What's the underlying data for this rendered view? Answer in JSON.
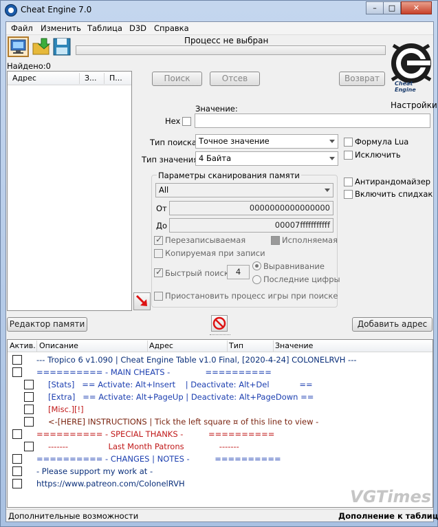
{
  "window": {
    "title": "Cheat Engine 7.0"
  },
  "menu": [
    "Файл",
    "Изменить",
    "Таблица",
    "D3D",
    "Справка"
  ],
  "process": {
    "label": "Процесс не выбран",
    "found": "Найдено:0"
  },
  "address_list": {
    "columns": [
      "Адрес",
      "З...",
      "П..."
    ]
  },
  "buttons": {
    "search": "Поиск",
    "filter": "Отсев",
    "return": "Возврат",
    "memory_editor": "Редактор памяти",
    "add_address": "Добавить адрес"
  },
  "logo": {
    "text": "Cheat Engine"
  },
  "settings_label": "Настройки",
  "value": {
    "label": "Значение:",
    "hex_label": "Hex",
    "value": ""
  },
  "scan_type": {
    "label": "Тип поиска",
    "selected": "Точное значение"
  },
  "value_type": {
    "label": "Тип значения",
    "selected": "4 Байта"
  },
  "memory_scan": {
    "title": "Параметры сканирования памяти",
    "region": "All",
    "from_label": "От",
    "from": "0000000000000000",
    "to_label": "До",
    "to": "00007fffffffffff",
    "writable": "Перезаписываемая",
    "executable": "Исполняемая",
    "copy_on_write": "Копируемая при записи",
    "fast_scan": "Быстрый поиск",
    "fast_scan_value": "4",
    "alignment": "Выравнивание",
    "last_digits": "Последние цифры",
    "pause": "Приостановить процесс игры при поиске"
  },
  "options": {
    "lua_formula": "Формула Lua",
    "exclude": "Исключить",
    "anti_randomizer": "Антирандомайзер",
    "speedhack": "Включить спидхак"
  },
  "table": {
    "columns": [
      "Актив.",
      "Описание",
      "Адрес",
      "Тип",
      "Значение"
    ],
    "rows": [
      {
        "text": "--- Tropico 6 v1.090 | Cheat Engine Table v1.0 Final, [2020-4-24] COLONELRVH ---",
        "color": "#0a2f7a",
        "indent": 0
      },
      {
        "text": "========== - MAIN CHEATS -              ==========",
        "color": "#1c3fb0",
        "indent": 0
      },
      {
        "text": "[Stats]   == Activate: Alt+Insert    | Deactivate: Alt+Del            ==",
        "color": "#1c3fb0",
        "indent": 1
      },
      {
        "text": "[Extra]   == Activate: Alt+PageUp | Deactivate: Alt+PageDown ==",
        "color": "#1c3fb0",
        "indent": 1
      },
      {
        "text": "[Misc.][!]",
        "color": "#c01818",
        "indent": 1
      },
      {
        "text": "<-[HERE] INSTRUCTIONS | Tick the left square ¤ of this line to view -",
        "color": "#7a2410",
        "indent": 1
      },
      {
        "text": "========== - SPECIAL THANKS -          ==========",
        "color": "#c01818",
        "indent": 0
      },
      {
        "text": "-------                Last Month Patrons              -------",
        "color": "#c01818",
        "indent": 1
      },
      {
        "text": "========== - CHANGES | NOTES -          ==========",
        "color": "#1c3fb0",
        "indent": 0
      },
      {
        "text": "- Please support my work at -",
        "color": "#0a2f7a",
        "indent": 0
      },
      {
        "text": "https://www.patreon.com/ColonelRVH",
        "color": "#0a2f7a",
        "indent": 0
      }
    ]
  },
  "status": {
    "left": "Дополнительные возможности",
    "right": "Дополнение к таблице"
  },
  "watermark": "VGTimes"
}
